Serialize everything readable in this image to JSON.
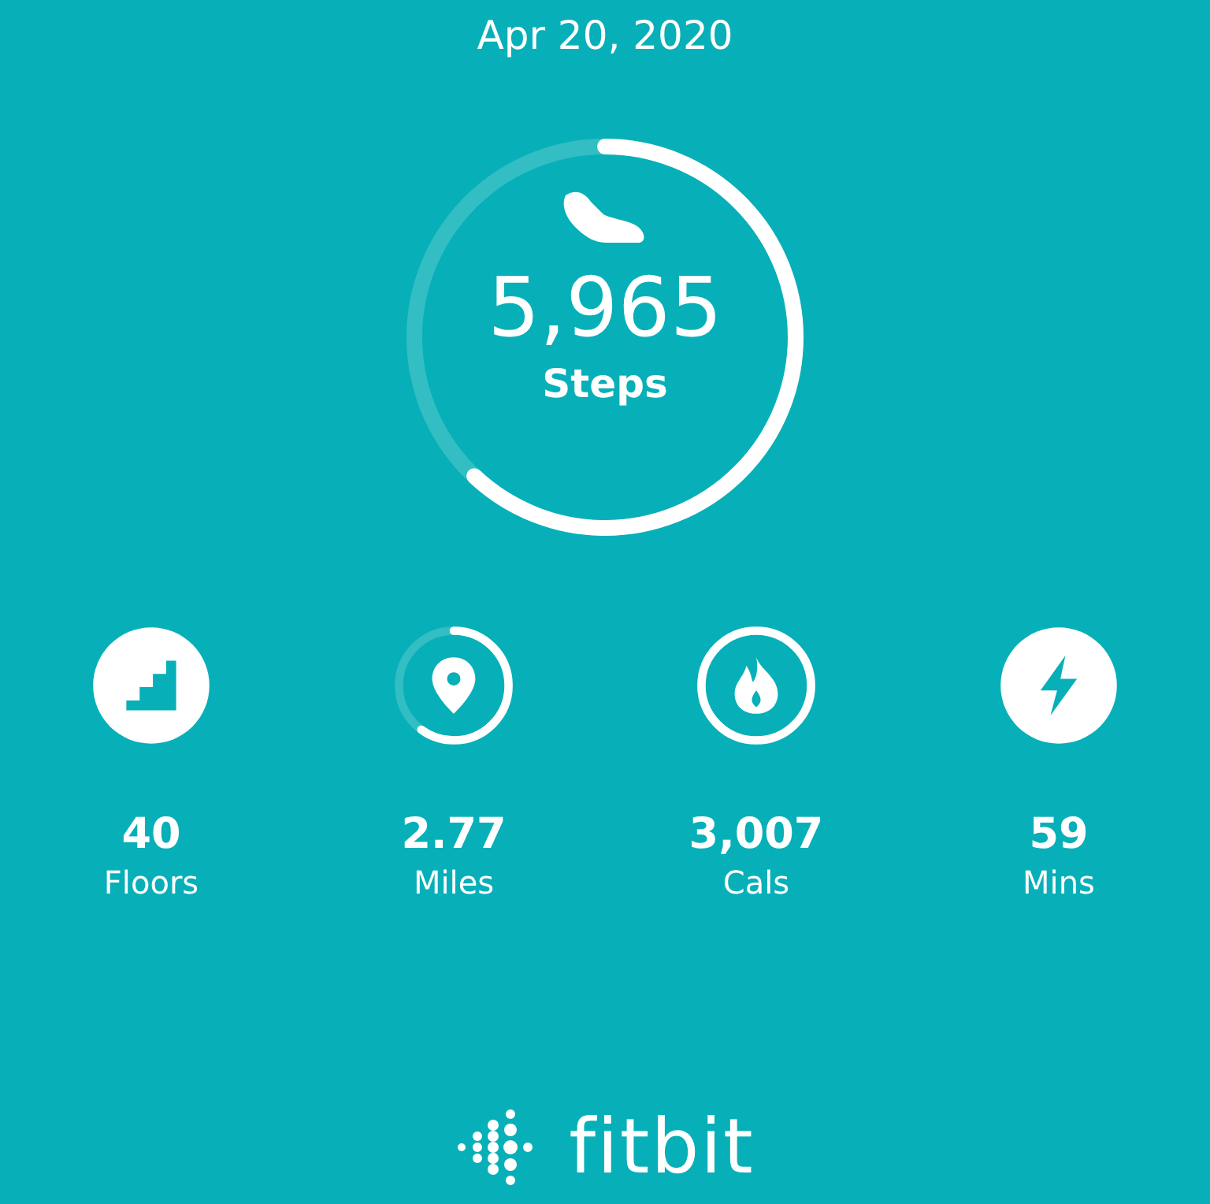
{
  "date": "Apr 20, 2020",
  "steps": {
    "value": "5,965",
    "label": "Steps",
    "level": 0.62
  },
  "stats": [
    {
      "kind": "floors",
      "value": "40",
      "label": "Floors",
      "goal_met": true
    },
    {
      "kind": "miles",
      "value": "2.77",
      "label": "Miles",
      "goal_met": false,
      "level": 0.6
    },
    {
      "kind": "calories",
      "value": "3,007",
      "label": "Cals",
      "goal_met": false,
      "level": 1
    },
    {
      "kind": "minutes",
      "value": "59",
      "label": "Mins",
      "goal_met": true
    }
  ],
  "brand": "fitbit"
}
